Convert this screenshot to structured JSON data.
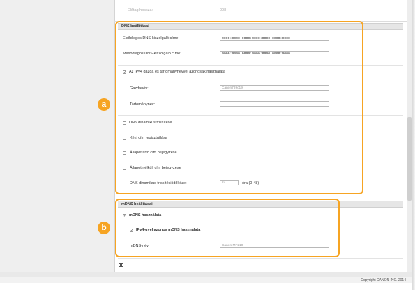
{
  "header_field": {
    "label": "Előtag hossza:",
    "value": "008"
  },
  "dns": {
    "title": "DNS beállításai",
    "primary_label": "Elsődleges DNS-kiszolgáló címe:",
    "primary_value": "0000:0000:0000:0000:0000:0000:0000",
    "secondary_label": "Másodlagos DNS-kiszolgáló címe:",
    "secondary_value": "0000:0000:0000:0000:0000:0000:0000",
    "use_ipv4_label": "Az IPv4 gazda és tartománynévvel azonosak használata",
    "use_ipv4_checked": "✓",
    "hostname_label": "Gazdanév:",
    "hostname_value": "Canon789c19",
    "domain_label": "Tartománynév:",
    "domain_value": "",
    "dynamic_label": "DNS dinamikus frissítése",
    "manual_label": "Kézi cím regisztrálása",
    "stateful_label": "Állapottartó cím bejegyzése",
    "stateless_label": "Állapot nélküli cím bejegyzése",
    "interval_label": "DNS dinamikus frissítési időköze:",
    "interval_value": "24",
    "interval_unit": "óra (0-48)"
  },
  "mdns": {
    "title": "mDNS beállításai",
    "use_label": "mDNS használata",
    "use_checked": "✓",
    "ipv4_label": "IPv4-gyel azonos mDNS használata",
    "ipv4_checked": "✓",
    "name_label": "mDNS-név:",
    "name_value": "Canon MF210"
  },
  "badges": {
    "a": "a",
    "b": "b"
  },
  "footer": {
    "copyright": "Copyright CANON INC. 2014"
  },
  "colors": {
    "highlight": "#f6a423",
    "section_header": "#e6e6e6"
  },
  "icons": {
    "pager": "page-top-icon"
  }
}
